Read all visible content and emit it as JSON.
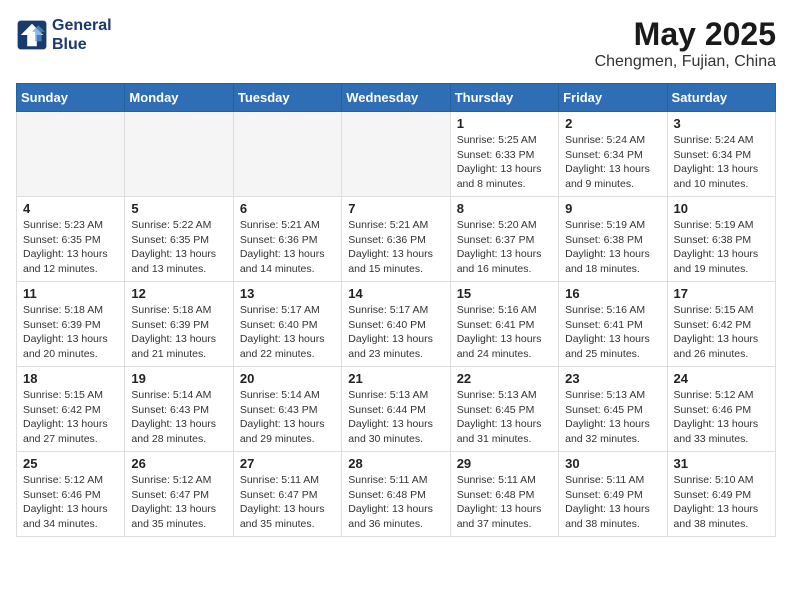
{
  "header": {
    "logo_line1": "General",
    "logo_line2": "Blue",
    "month_year": "May 2025",
    "location": "Chengmen, Fujian, China"
  },
  "weekdays": [
    "Sunday",
    "Monday",
    "Tuesday",
    "Wednesday",
    "Thursday",
    "Friday",
    "Saturday"
  ],
  "weeks": [
    [
      {
        "day": "",
        "info": ""
      },
      {
        "day": "",
        "info": ""
      },
      {
        "day": "",
        "info": ""
      },
      {
        "day": "",
        "info": ""
      },
      {
        "day": "1",
        "info": "Sunrise: 5:25 AM\nSunset: 6:33 PM\nDaylight: 13 hours\nand 8 minutes."
      },
      {
        "day": "2",
        "info": "Sunrise: 5:24 AM\nSunset: 6:34 PM\nDaylight: 13 hours\nand 9 minutes."
      },
      {
        "day": "3",
        "info": "Sunrise: 5:24 AM\nSunset: 6:34 PM\nDaylight: 13 hours\nand 10 minutes."
      }
    ],
    [
      {
        "day": "4",
        "info": "Sunrise: 5:23 AM\nSunset: 6:35 PM\nDaylight: 13 hours\nand 12 minutes."
      },
      {
        "day": "5",
        "info": "Sunrise: 5:22 AM\nSunset: 6:35 PM\nDaylight: 13 hours\nand 13 minutes."
      },
      {
        "day": "6",
        "info": "Sunrise: 5:21 AM\nSunset: 6:36 PM\nDaylight: 13 hours\nand 14 minutes."
      },
      {
        "day": "7",
        "info": "Sunrise: 5:21 AM\nSunset: 6:36 PM\nDaylight: 13 hours\nand 15 minutes."
      },
      {
        "day": "8",
        "info": "Sunrise: 5:20 AM\nSunset: 6:37 PM\nDaylight: 13 hours\nand 16 minutes."
      },
      {
        "day": "9",
        "info": "Sunrise: 5:19 AM\nSunset: 6:38 PM\nDaylight: 13 hours\nand 18 minutes."
      },
      {
        "day": "10",
        "info": "Sunrise: 5:19 AM\nSunset: 6:38 PM\nDaylight: 13 hours\nand 19 minutes."
      }
    ],
    [
      {
        "day": "11",
        "info": "Sunrise: 5:18 AM\nSunset: 6:39 PM\nDaylight: 13 hours\nand 20 minutes."
      },
      {
        "day": "12",
        "info": "Sunrise: 5:18 AM\nSunset: 6:39 PM\nDaylight: 13 hours\nand 21 minutes."
      },
      {
        "day": "13",
        "info": "Sunrise: 5:17 AM\nSunset: 6:40 PM\nDaylight: 13 hours\nand 22 minutes."
      },
      {
        "day": "14",
        "info": "Sunrise: 5:17 AM\nSunset: 6:40 PM\nDaylight: 13 hours\nand 23 minutes."
      },
      {
        "day": "15",
        "info": "Sunrise: 5:16 AM\nSunset: 6:41 PM\nDaylight: 13 hours\nand 24 minutes."
      },
      {
        "day": "16",
        "info": "Sunrise: 5:16 AM\nSunset: 6:41 PM\nDaylight: 13 hours\nand 25 minutes."
      },
      {
        "day": "17",
        "info": "Sunrise: 5:15 AM\nSunset: 6:42 PM\nDaylight: 13 hours\nand 26 minutes."
      }
    ],
    [
      {
        "day": "18",
        "info": "Sunrise: 5:15 AM\nSunset: 6:42 PM\nDaylight: 13 hours\nand 27 minutes."
      },
      {
        "day": "19",
        "info": "Sunrise: 5:14 AM\nSunset: 6:43 PM\nDaylight: 13 hours\nand 28 minutes."
      },
      {
        "day": "20",
        "info": "Sunrise: 5:14 AM\nSunset: 6:43 PM\nDaylight: 13 hours\nand 29 minutes."
      },
      {
        "day": "21",
        "info": "Sunrise: 5:13 AM\nSunset: 6:44 PM\nDaylight: 13 hours\nand 30 minutes."
      },
      {
        "day": "22",
        "info": "Sunrise: 5:13 AM\nSunset: 6:45 PM\nDaylight: 13 hours\nand 31 minutes."
      },
      {
        "day": "23",
        "info": "Sunrise: 5:13 AM\nSunset: 6:45 PM\nDaylight: 13 hours\nand 32 minutes."
      },
      {
        "day": "24",
        "info": "Sunrise: 5:12 AM\nSunset: 6:46 PM\nDaylight: 13 hours\nand 33 minutes."
      }
    ],
    [
      {
        "day": "25",
        "info": "Sunrise: 5:12 AM\nSunset: 6:46 PM\nDaylight: 13 hours\nand 34 minutes."
      },
      {
        "day": "26",
        "info": "Sunrise: 5:12 AM\nSunset: 6:47 PM\nDaylight: 13 hours\nand 35 minutes."
      },
      {
        "day": "27",
        "info": "Sunrise: 5:11 AM\nSunset: 6:47 PM\nDaylight: 13 hours\nand 35 minutes."
      },
      {
        "day": "28",
        "info": "Sunrise: 5:11 AM\nSunset: 6:48 PM\nDaylight: 13 hours\nand 36 minutes."
      },
      {
        "day": "29",
        "info": "Sunrise: 5:11 AM\nSunset: 6:48 PM\nDaylight: 13 hours\nand 37 minutes."
      },
      {
        "day": "30",
        "info": "Sunrise: 5:11 AM\nSunset: 6:49 PM\nDaylight: 13 hours\nand 38 minutes."
      },
      {
        "day": "31",
        "info": "Sunrise: 5:10 AM\nSunset: 6:49 PM\nDaylight: 13 hours\nand 38 minutes."
      }
    ]
  ]
}
